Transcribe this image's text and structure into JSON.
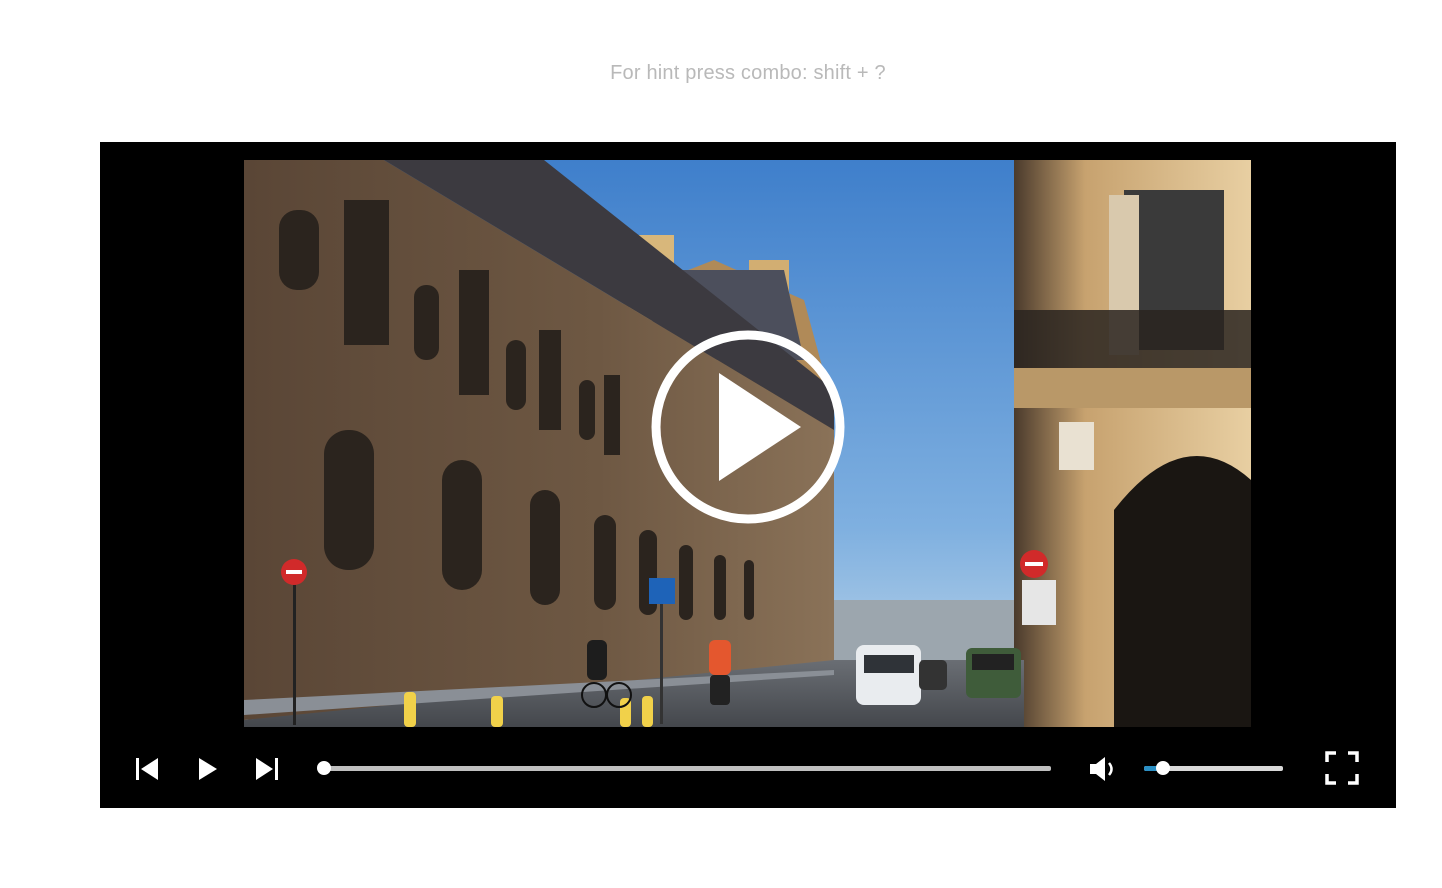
{
  "hint": {
    "text": "For hint press combo: shift + ?"
  },
  "video": {
    "scene": "street-view-photo",
    "overlay_icon": "play-circle-icon"
  },
  "controls": {
    "previous_icon": "skip-previous-icon",
    "play_icon": "play-icon",
    "next_icon": "skip-next-icon",
    "progress_fraction": 0.0,
    "mute_icon": "volume-low-icon",
    "volume_fraction": 0.14,
    "fullscreen_icon": "fullscreen-icon"
  },
  "colors": {
    "player_bg": "#000000",
    "accent": "#2a8fc4",
    "track": "#bfbfbf",
    "hint_text": "#b9b9b9"
  }
}
